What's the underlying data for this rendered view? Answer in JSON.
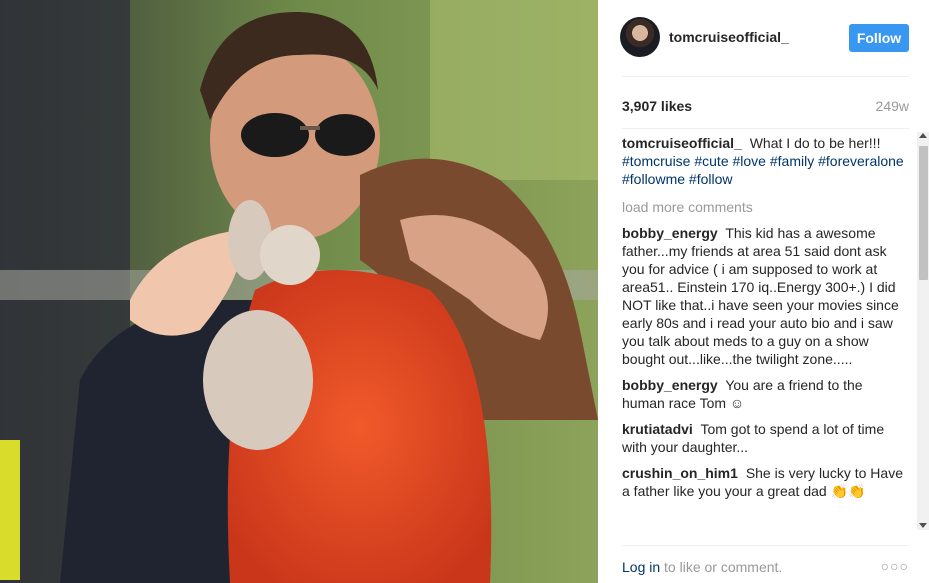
{
  "post": {
    "username": "tomcruiseofficial_",
    "follow_label": "Follow",
    "likes": "3,907 likes",
    "age": "249w",
    "caption_user": "tomcruiseofficial_",
    "caption_text": "What I do to be her!!!",
    "caption_tags": [
      "#tomcruise",
      "#cute",
      "#love",
      "#family",
      "#foreveralone",
      "#followme",
      "#follow"
    ],
    "load_more": "load more comments",
    "comments": [
      {
        "user": "bobby_energy",
        "text": "This kid has a awesome father...my friends at area 51 said dont ask you for advice ( i am supposed to work at area51.. Einstein 170 iq..Energy 300+.) I did NOT like that..i have seen your movies since early 80s and i read your auto bio and i saw you talk about meds to a guy on a show bought out...like...the twilight zone....."
      },
      {
        "user": "bobby_energy",
        "text": "You are a friend to the human race Tom ☺"
      },
      {
        "user": "krutiatadvi",
        "text": "Tom got to spend a lot of time with your daughter..."
      },
      {
        "user": "crushin_on_him1",
        "text": "She is very lucky to Have a father like you your a great dad 👏👏"
      }
    ],
    "login_link": "Log in",
    "login_rest": " to like or comment.",
    "more_icon": "more-options-icon"
  },
  "colors": {
    "follow_button": "#3897f0",
    "hashtag": "#003569",
    "muted": "#999999"
  }
}
